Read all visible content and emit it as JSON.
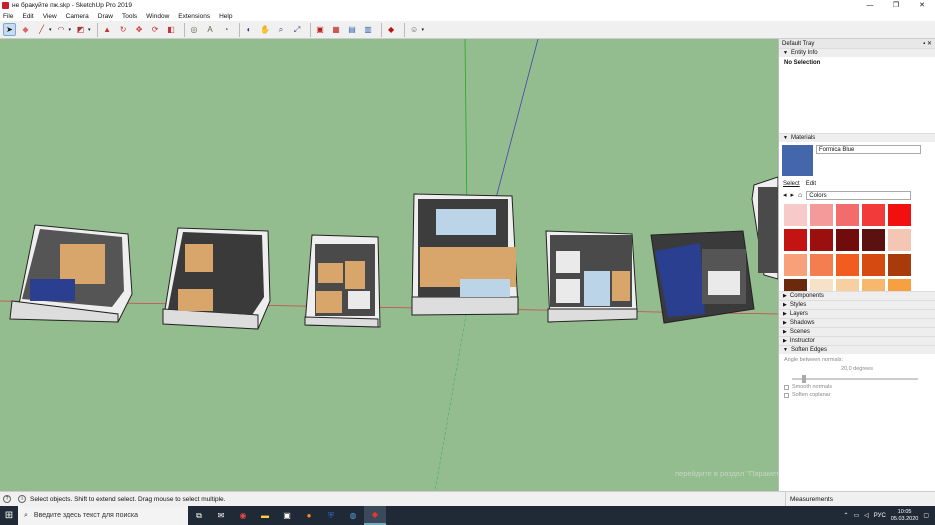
{
  "window": {
    "title": "не бракуйте пж.skp - SketchUp Pro 2019",
    "minimize": "—",
    "maximize": "❐",
    "close": "✕"
  },
  "menu": [
    "File",
    "Edit",
    "View",
    "Camera",
    "Draw",
    "Tools",
    "Window",
    "Extensions",
    "Help"
  ],
  "toolbar": {
    "icons": [
      "select-icon",
      "eraser-icon",
      "line-icon",
      "arc-icon",
      "shape-icon",
      "push-pull-icon",
      "follow-me-icon",
      "move-icon",
      "rotate-icon",
      "scale-icon",
      "offset-icon",
      "tape-measure-icon",
      "text-icon",
      "protractor-icon",
      "orbit-icon",
      "pan-icon",
      "zoom-icon",
      "zoom-extents-icon",
      "warehouse-icon",
      "extension-warehouse-icon",
      "layout-icon",
      "style-builder-icon",
      "ruby-icon",
      "account-icon"
    ]
  },
  "tray": {
    "title": "Default Tray",
    "entity_info": {
      "label": "Entity Info",
      "value": "No Selection"
    },
    "materials": {
      "label": "Materials",
      "name": "Formica Blue",
      "tab_select": "Select",
      "tab_edit": "Edit",
      "collection": "Colors",
      "swatch_color": "#4466aa",
      "palette": [
        "#f7c9c9",
        "#f49a9a",
        "#f26c6c",
        "#f23a3a",
        "#f20f0f",
        "#c41313",
        "#9b0f0f",
        "#700c0c",
        "#5c1111",
        "#f4c7b4",
        "#f7a07a",
        "#f47e4f",
        "#f25c1e",
        "#d44a10",
        "#a83a0c",
        "#6b2a0e",
        "#f7e2c8",
        "#f7cfa0",
        "#f7b86e",
        "#f7a040"
      ]
    },
    "collapsed": [
      "Components",
      "Styles",
      "Layers",
      "Shadows",
      "Scenes",
      "Instructor"
    ],
    "soften": {
      "label": "Soften Edges",
      "angle_label": "Angle between normals:",
      "angle_value": "20,0  degrees",
      "smooth": "Smooth normals",
      "coplanar": "Soften coplanar"
    }
  },
  "watermark": "перейдите в раздел \"Параметры\".",
  "status": {
    "text": "Select objects. Shift to extend select. Drag mouse to select multiple.",
    "measurements": "Measurements"
  },
  "taskbar": {
    "search_placeholder": "Введите здесь текст для поиска",
    "lang": "РУС",
    "time": "10:05",
    "date": "05.03.2020"
  }
}
